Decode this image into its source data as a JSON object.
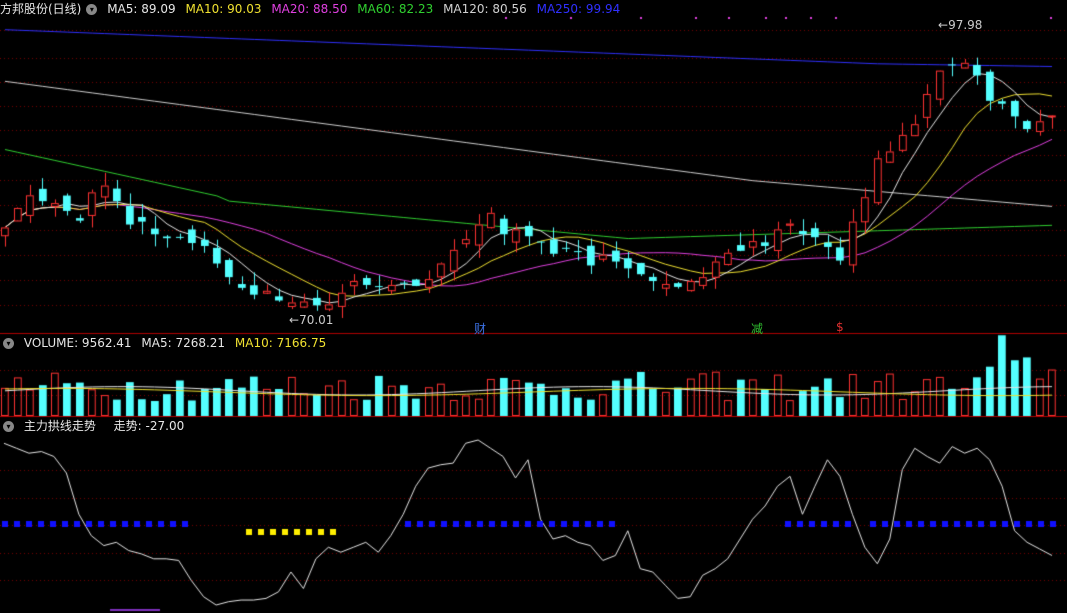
{
  "stock": {
    "name": "方邦股份(日线)"
  },
  "price_panel": {
    "ma_labels": [
      {
        "text": "MA5: 89.09",
        "color": "#e6e6e6"
      },
      {
        "text": "MA10: 90.03",
        "color": "#f0e130"
      },
      {
        "text": "MA20: 88.50",
        "color": "#e040e0"
      },
      {
        "text": "MA60: 82.23",
        "color": "#30d030"
      },
      {
        "text": "MA120: 80.56",
        "color": "#d0d0d0"
      },
      {
        "text": "MA250: 99.94",
        "color": "#3030ff"
      }
    ],
    "high_label": "97.98",
    "low_label": "70.01",
    "markers": [
      {
        "text": "财",
        "color": "#3a6fe0"
      },
      {
        "text": "减",
        "color": "#30c030"
      },
      {
        "text": "$",
        "color": "#e03030"
      }
    ]
  },
  "volume_panel": {
    "labels": [
      {
        "text": "VOLUME: 9562.41",
        "color": "#e6e6e6"
      },
      {
        "text": "MA5: 7268.21",
        "color": "#e6e6e6"
      },
      {
        "text": "MA10: 7166.75",
        "color": "#f0e130"
      }
    ]
  },
  "indicator_panel": {
    "title": "主力拱线走势",
    "value_label": "走势: -27.00"
  },
  "colors": {
    "up": "#ff3232",
    "down": "#54ffff",
    "grid": "#7a0000",
    "ma250": "#3030ff",
    "ma120": "#d0d0d0",
    "ma60": "#30d030",
    "ma20": "#e040e0",
    "ma10": "#f0e130",
    "ma5": "#e6e6e6",
    "blue_dots": "#1010ff",
    "yellow_dots": "#ffee00"
  },
  "chart_data": {
    "type": "candlestick",
    "close": [
      78.5,
      80.5,
      81.8,
      81.2,
      81.0,
      80.2,
      79.2,
      82.1,
      82.8,
      81.2,
      78.8,
      79.1,
      77.8,
      77.4,
      77.5,
      76.9,
      76.6,
      74.8,
      73.4,
      72.3,
      71.6,
      72.0,
      71.0,
      70.8,
      70.9,
      70.5,
      70.6,
      71.8,
      73.0,
      72.6,
      72.4,
      72.6,
      72.8,
      72.5,
      73.2,
      74.8,
      76.2,
      77.3,
      78.8,
      80.0,
      77.8,
      78.3,
      77.6,
      77.0,
      75.8,
      76.4,
      76.0,
      74.6,
      75.7,
      75.0,
      74.3,
      73.7,
      73.0,
      72.7,
      72.4,
      73.0,
      73.4,
      75.0,
      75.9,
      76.1,
      77.1,
      76.6,
      78.3,
      78.9,
      77.8,
      77.5,
      76.5,
      75.1,
      79.1,
      81.6,
      85.6,
      86.3,
      88.0,
      89.1,
      92.2,
      94.6,
      95.2,
      95.4,
      94.1,
      91.5,
      91.2,
      89.9,
      88.6,
      89.4,
      90.0
    ]
  }
}
